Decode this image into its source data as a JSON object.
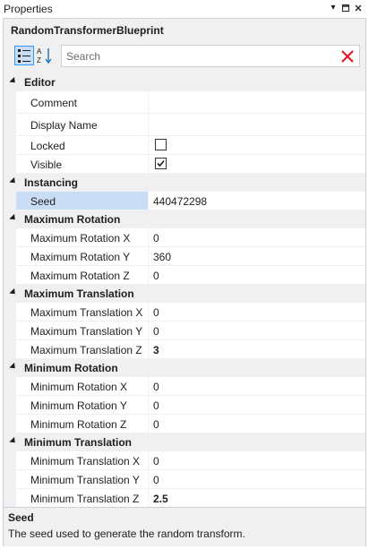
{
  "window": {
    "title": "Properties"
  },
  "object_name": "RandomTransformerBlueprint",
  "search": {
    "placeholder": "Search"
  },
  "icons": {
    "categorized": "categorized-icon",
    "alphabetical": "sort-alpha-icon",
    "clear": "clear-x-icon",
    "dropdown": "dropdown-arrow-icon",
    "pin": "pin-icon",
    "close": "close-icon"
  },
  "colors": {
    "selected": "#c9def5",
    "clear": "#e81123"
  },
  "categories": [
    {
      "label": "Editor",
      "rows": [
        {
          "name": "Comment",
          "value": ""
        },
        {
          "name": "Display Name",
          "value": ""
        },
        {
          "name": "Locked",
          "checkbox": false
        },
        {
          "name": "Visible",
          "checkbox": true
        }
      ]
    },
    {
      "label": "Instancing",
      "rows": [
        {
          "name": "Seed",
          "value": "440472298",
          "selected": true
        }
      ]
    },
    {
      "label": "Maximum Rotation",
      "rows": [
        {
          "name": "Maximum Rotation X",
          "value": "0"
        },
        {
          "name": "Maximum Rotation Y",
          "value": "360"
        },
        {
          "name": "Maximum Rotation Z",
          "value": "0"
        }
      ]
    },
    {
      "label": "Maximum Translation",
      "rows": [
        {
          "name": "Maximum Translation X",
          "value": "0"
        },
        {
          "name": "Maximum Translation Y",
          "value": "0"
        },
        {
          "name": "Maximum Translation Z",
          "value": "3",
          "modified": true
        }
      ]
    },
    {
      "label": "Minimum Rotation",
      "rows": [
        {
          "name": "Minimum Rotation X",
          "value": "0"
        },
        {
          "name": "Minimum Rotation Y",
          "value": "0"
        },
        {
          "name": "Minimum Rotation Z",
          "value": "0"
        }
      ]
    },
    {
      "label": "Minimum Translation",
      "rows": [
        {
          "name": "Minimum Translation X",
          "value": "0"
        },
        {
          "name": "Minimum Translation Y",
          "value": "0"
        },
        {
          "name": "Minimum Translation Z",
          "value": "2.5",
          "modified": true
        }
      ]
    }
  ],
  "description": {
    "title": "Seed",
    "text": "The seed used to generate the random transform."
  }
}
